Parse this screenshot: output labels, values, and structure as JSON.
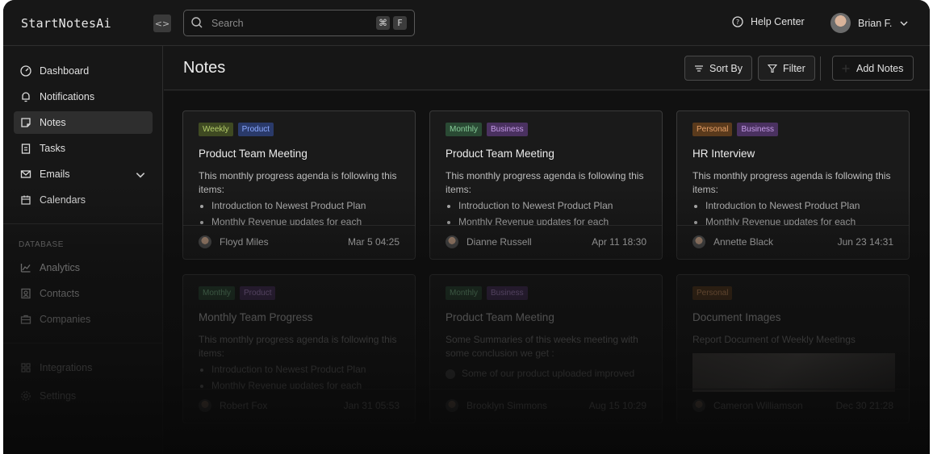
{
  "app": {
    "logo": "StartNotesAi",
    "collapse_glyph": "<>"
  },
  "search": {
    "placeholder": "Search",
    "shortcut_mod": "⌘",
    "shortcut_key": "F"
  },
  "header": {
    "help": "Help Center",
    "user_name": "Brian F."
  },
  "sidebar": {
    "items": [
      {
        "label": "Dashboard",
        "icon": "dashboard-icon"
      },
      {
        "label": "Notifications",
        "icon": "bell-icon"
      },
      {
        "label": "Notes",
        "icon": "note-icon",
        "active": true
      },
      {
        "label": "Tasks",
        "icon": "clipboard-icon"
      },
      {
        "label": "Emails",
        "icon": "mail-icon"
      },
      {
        "label": "Calendars",
        "icon": "calendar-icon"
      }
    ],
    "database_label": "DATABASE",
    "database_items": [
      {
        "label": "Analytics",
        "icon": "chart-icon"
      },
      {
        "label": "Contacts",
        "icon": "contact-icon"
      },
      {
        "label": "Companies",
        "icon": "briefcase-icon"
      }
    ],
    "bottom_items": [
      {
        "label": "Integrations",
        "icon": "grid-icon"
      },
      {
        "label": "Settings",
        "icon": "gear-icon"
      }
    ]
  },
  "main": {
    "title": "Notes",
    "sort_label": "Sort By",
    "filter_label": "Filter",
    "add_label": "Add Notes"
  },
  "notes": [
    {
      "tags": [
        "Weekly",
        "Product"
      ],
      "title": "Product Team Meeting",
      "intro": "This monthly progress agenda is following this items:",
      "bullets": [
        "Introduction to Newest Product Plan",
        "Monthly Revenue updates for each"
      ],
      "author": "Floyd Miles",
      "date": "Mar 5 04:25"
    },
    {
      "tags": [
        "Monthly",
        "Business"
      ],
      "title": "Product Team Meeting",
      "intro": "This monthly progress agenda is following this items:",
      "bullets": [
        "Introduction to Newest Product Plan",
        "Monthly Revenue updates for each"
      ],
      "author": "Dianne Russell",
      "date": "Apr 11 18:30"
    },
    {
      "tags": [
        "Personal",
        "Business"
      ],
      "title": "HR Interview",
      "intro": "This monthly progress agenda is following this items:",
      "bullets": [
        "Introduction to Newest Product Plan",
        "Monthly Revenue updates for each"
      ],
      "author": "Annette Black",
      "date": "Jun 23 14:31"
    },
    {
      "tags": [
        "Monthly",
        "Product"
      ],
      "title": "Monthly Team Progress",
      "intro": "This monthly progress agenda is following this items:",
      "bullets": [
        "Introduction to Newest Product Plan",
        "Monthly Revenue updates for each"
      ],
      "author": "Robert Fox",
      "date": "Jan 31 05:53"
    },
    {
      "tags": [
        "Monthly",
        "Business"
      ],
      "title": "Product Team Meeting",
      "intro": "Some Summaries of this weeks meeting with some conclusion we get :",
      "checklist": [
        "Some of our product uploaded improved"
      ],
      "author": "Brooklyn Simmons",
      "date": "Aug 15 10:29"
    },
    {
      "tags": [
        "Personal"
      ],
      "title": "Document Images",
      "intro": "Report Document of Weekly Meetings",
      "author": "Cameron Williamson",
      "date": "Dec 30 21:28"
    }
  ],
  "colors": {
    "background": "#161616",
    "card": "#1a1a1a",
    "border": "#3a3a3a"
  }
}
